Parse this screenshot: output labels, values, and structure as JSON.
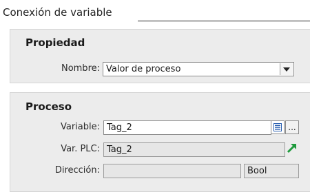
{
  "header": {
    "title": "Conexión de variable"
  },
  "propiedad": {
    "title": "Propiedad",
    "nombre_label": "Nombre:",
    "nombre_value": "Valor de proceso"
  },
  "proceso": {
    "title": "Proceso",
    "variable_label": "Variable:",
    "variable_value": "Tag_2",
    "varplc_label": "Var. PLC:",
    "varplc_value": "Tag_2",
    "direccion_label": "Dirección:",
    "direccion_value": "",
    "tipo_value": "Bool",
    "more_button_label": "...",
    "list_icon": "list-icon",
    "goto_icon": "green-arrow-icon"
  },
  "colors": {
    "panel_bg": "#ececec",
    "arrow_green": "#1e9a3c",
    "list_icon_blue": "#2a5fb0"
  }
}
